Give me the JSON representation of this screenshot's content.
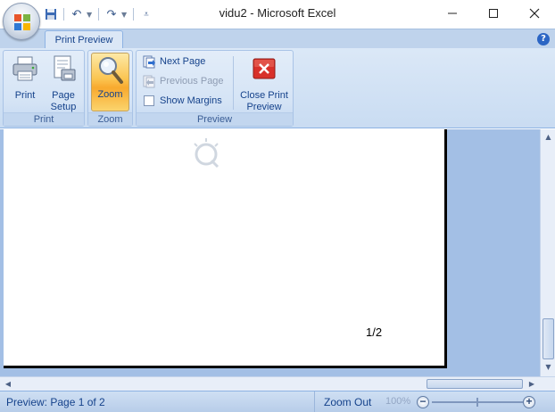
{
  "window": {
    "title": "vidu2 - Microsoft Excel",
    "minimize_glyph": "—",
    "maximize_glyph": "☐",
    "close_glyph": "✕"
  },
  "quick_access": {
    "icons": [
      "save-icon",
      "undo-icon",
      "redo-icon",
      "customize-icon"
    ]
  },
  "ribbon": {
    "active_tab": "Print Preview",
    "help_glyph": "?",
    "groups": {
      "print": {
        "label": "Print",
        "buttons": {
          "print": "Print",
          "page_setup_line1": "Page",
          "page_setup_line2": "Setup"
        }
      },
      "zoom": {
        "label": "Zoom",
        "buttons": {
          "zoom": "Zoom"
        }
      },
      "preview": {
        "label": "Preview",
        "next_page": "Next Page",
        "previous_page": "Previous Page",
        "show_margins": "Show Margins",
        "close_line1": "Close Print",
        "close_line2": "Preview"
      }
    }
  },
  "preview": {
    "page_number": "1/2"
  },
  "status": {
    "text": "Preview: Page 1 of 2",
    "zoom_out": "Zoom Out",
    "zoom_percent": "100%",
    "minus": "−",
    "plus": "+"
  },
  "colors": {
    "ribbon_bg": "#dbe8f7",
    "preview_bg": "#a3bfe5",
    "zoom_active": "#fbc450",
    "close_red": "#d8302a",
    "text_blue": "#15428b"
  }
}
